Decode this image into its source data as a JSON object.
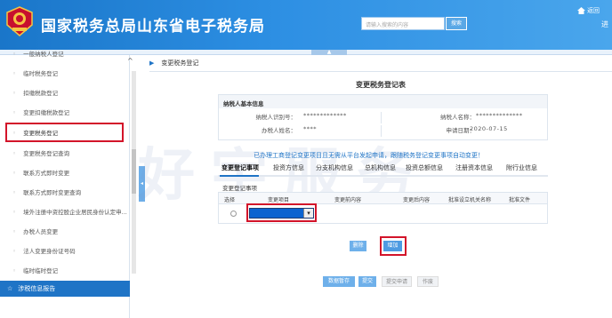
{
  "header": {
    "title": "国家税务总局山东省电子税务局",
    "search_placeholder": "请输入搜索的内容",
    "search_button": "搜索",
    "home_link": "返回",
    "extra": "进"
  },
  "sidebar": {
    "items": [
      {
        "label": "一般纳税人登记"
      },
      {
        "label": "临时税务登记"
      },
      {
        "label": "扣缴税款登记"
      },
      {
        "label": "变更扣缴税款登记"
      },
      {
        "label": "变更税务登记"
      },
      {
        "label": "变更税务登记查询"
      },
      {
        "label": "联系方式即时变更"
      },
      {
        "label": "联系方式即时变更查询"
      },
      {
        "label": "境外注册中资控股企业居民身份认定申..."
      },
      {
        "label": "办税人员变更"
      },
      {
        "label": "法人变更身份证号码"
      },
      {
        "label": "临时临时登记"
      }
    ],
    "footer": "涉税信息报告",
    "toggle": "◂"
  },
  "breadcrumb": "变更税务登记",
  "form": {
    "title": "变更税务登记表",
    "panel_title": "纳税人基本信息",
    "rows": [
      {
        "l1": "纳税人识别号：",
        "v1": "*************",
        "l2": "纳税人名称：",
        "v2": "**************"
      },
      {
        "l1": "办税人姓名：",
        "v1": "****",
        "l2": "申请日期：",
        "v2": "2020-07-15"
      }
    ]
  },
  "notice": "已办理工商登记变更项目且无需从平台发起申请，跟随税务登记变更事项自动变更！",
  "tabs": [
    "变更登记事项",
    "投资方信息",
    "分支机构信息",
    "总机构信息",
    "投资总额信息",
    "注册资本信息",
    "附行业信息"
  ],
  "section_title": "变更登记事项",
  "grid_headers": [
    "选择",
    "变更项目",
    "变更前内容",
    "变更后内容",
    "批准设立机关名称",
    "批准文件"
  ],
  "buttons": {
    "delete": "删除",
    "add": "增加",
    "save": "数据暂存",
    "submit": "提交",
    "attach": "提交申请",
    "void": "作废"
  },
  "watermark": "好宇服务",
  "colors": {
    "header_blue": "#1a76c9",
    "accent": "#1f74c6",
    "highlight_red": "#d3142a"
  }
}
